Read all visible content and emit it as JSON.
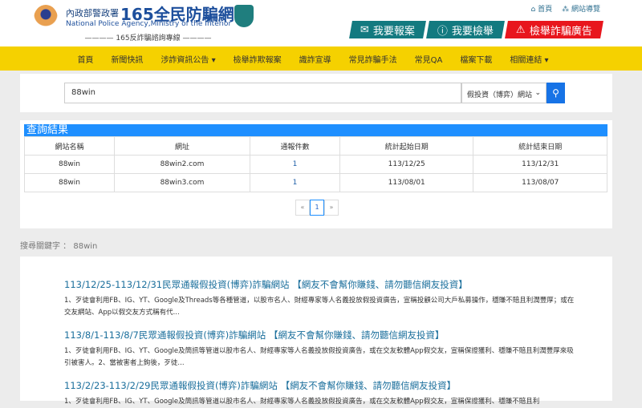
{
  "header": {
    "org": "內政部警政署",
    "brand": "165全民防騙網",
    "english": "National Police Agency,Ministry of the Interior",
    "tagline": "———— 165反詐騙諮詢專線 ————",
    "toplinks": [
      {
        "icon": "home-icon",
        "label": "首頁"
      },
      {
        "icon": "sitemap-icon",
        "label": "網站導覽"
      }
    ],
    "actions": [
      {
        "icon": "envelope-icon",
        "label": "我要報案",
        "color": "#137a80"
      },
      {
        "icon": "exclamation-icon",
        "label": "我要檢舉",
        "color": "#137a80"
      },
      {
        "icon": "warning-icon",
        "label": "檢舉詐騙廣告",
        "color": "#e8161d"
      }
    ]
  },
  "nav": [
    "首頁",
    "新聞快訊",
    "涉詐資訊公告 ▾",
    "檢舉詐欺報案",
    "識詐宣導",
    "常見詐騙手法",
    "常見QA",
    "檔案下載",
    "相關連結 ▾"
  ],
  "search": {
    "value": "88win",
    "select": "假投資（博弈）網站",
    "button_icon": "search-icon"
  },
  "results": {
    "title": "查詢結果",
    "columns": [
      "網站名稱",
      "網址",
      "通報件數",
      "統計起始日期",
      "統計結束日期"
    ],
    "rows": [
      [
        "88win",
        "88win2.com",
        "1",
        "113/12/25",
        "113/12/31"
      ],
      [
        "88win",
        "88win3.com",
        "1",
        "113/08/01",
        "113/08/07"
      ]
    ],
    "pager": {
      "prev": "«",
      "current": "1",
      "next": "»"
    }
  },
  "keyword": "搜尋關鍵字 ： 88win",
  "articles": [
    {
      "title": "113/12/25-113/12/31民眾通報假投資(博弈)詐騙網站 【網友不會幫你賺錢、請勿聽信網友投資】",
      "desc": "1、歹徒會利用FB、IG、YT、Google及Threads等各種管道，以股市名人、財經專家等人名義投放假投資廣告，宣稱投顧公司大戶私募操作，穩賺不賠且利潤豐厚；或在交友網站、App以假交友方式稱有代..."
    },
    {
      "title": "113/8/1-113/8/7民眾通報假投資(博弈)詐騙網站 【網友不會幫你賺錢、請勿聽信網友投資】",
      "desc": "1、歹徒會利用FB、IG、YT、Google及簡訊等管道以股市名人、財經專家等人名義投放假投資廣告，或在交友軟體App假交友，宣稱保證獲利、穩賺不賠且利潤豐厚來吸引被害人。2、當被害者上鉤後，歹徒..."
    },
    {
      "title": "113/2/23-113/2/29民眾通報假投資(博弈)詐騙網站 【網友不會幫你賺錢、請勿聽信網友投資】",
      "desc": "1、歹徒會利用FB、IG、YT、Google及簡訊等管道以股市名人、財經專家等人名義投放假投資廣告，或在交友軟體App假交友，宣稱保證獲利、穩賺不賠且利"
    }
  ]
}
